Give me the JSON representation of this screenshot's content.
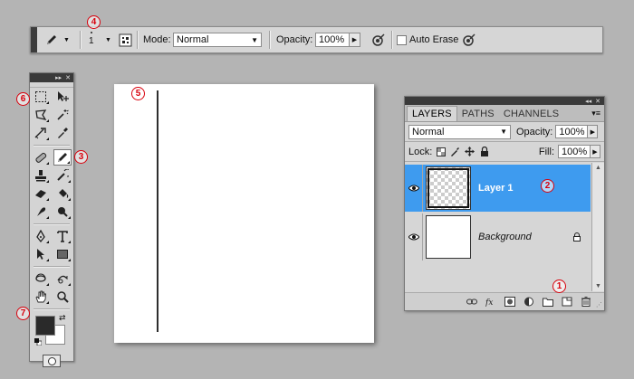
{
  "options_bar": {
    "brush_size": "1",
    "mode_label": "Mode:",
    "mode_value": "Normal",
    "opacity_label": "Opacity:",
    "opacity_value": "100%",
    "auto_erase_label": "Auto Erase",
    "auto_erase_checked": false
  },
  "tools_panel": {
    "foreground_color": "#2a2a2a",
    "background_color": "#ffffff",
    "active_tool": "pencil-tool"
  },
  "layers_panel": {
    "tabs": [
      {
        "label": "LAYERS",
        "active": true
      },
      {
        "label": "PATHS",
        "active": false
      },
      {
        "label": "CHANNELS",
        "active": false
      }
    ],
    "blend_mode": "Normal",
    "opacity_label": "Opacity:",
    "opacity_value": "100%",
    "lock_label": "Lock:",
    "fill_label": "Fill:",
    "fill_value": "100%",
    "layers": [
      {
        "name": "Layer 1",
        "selected": true,
        "visible": true
      },
      {
        "name": "Background",
        "selected": false,
        "visible": true,
        "locked": true
      }
    ],
    "selection_color": "#3e9bef"
  },
  "callouts": [
    "1",
    "2",
    "3",
    "4",
    "5",
    "6",
    "7"
  ]
}
